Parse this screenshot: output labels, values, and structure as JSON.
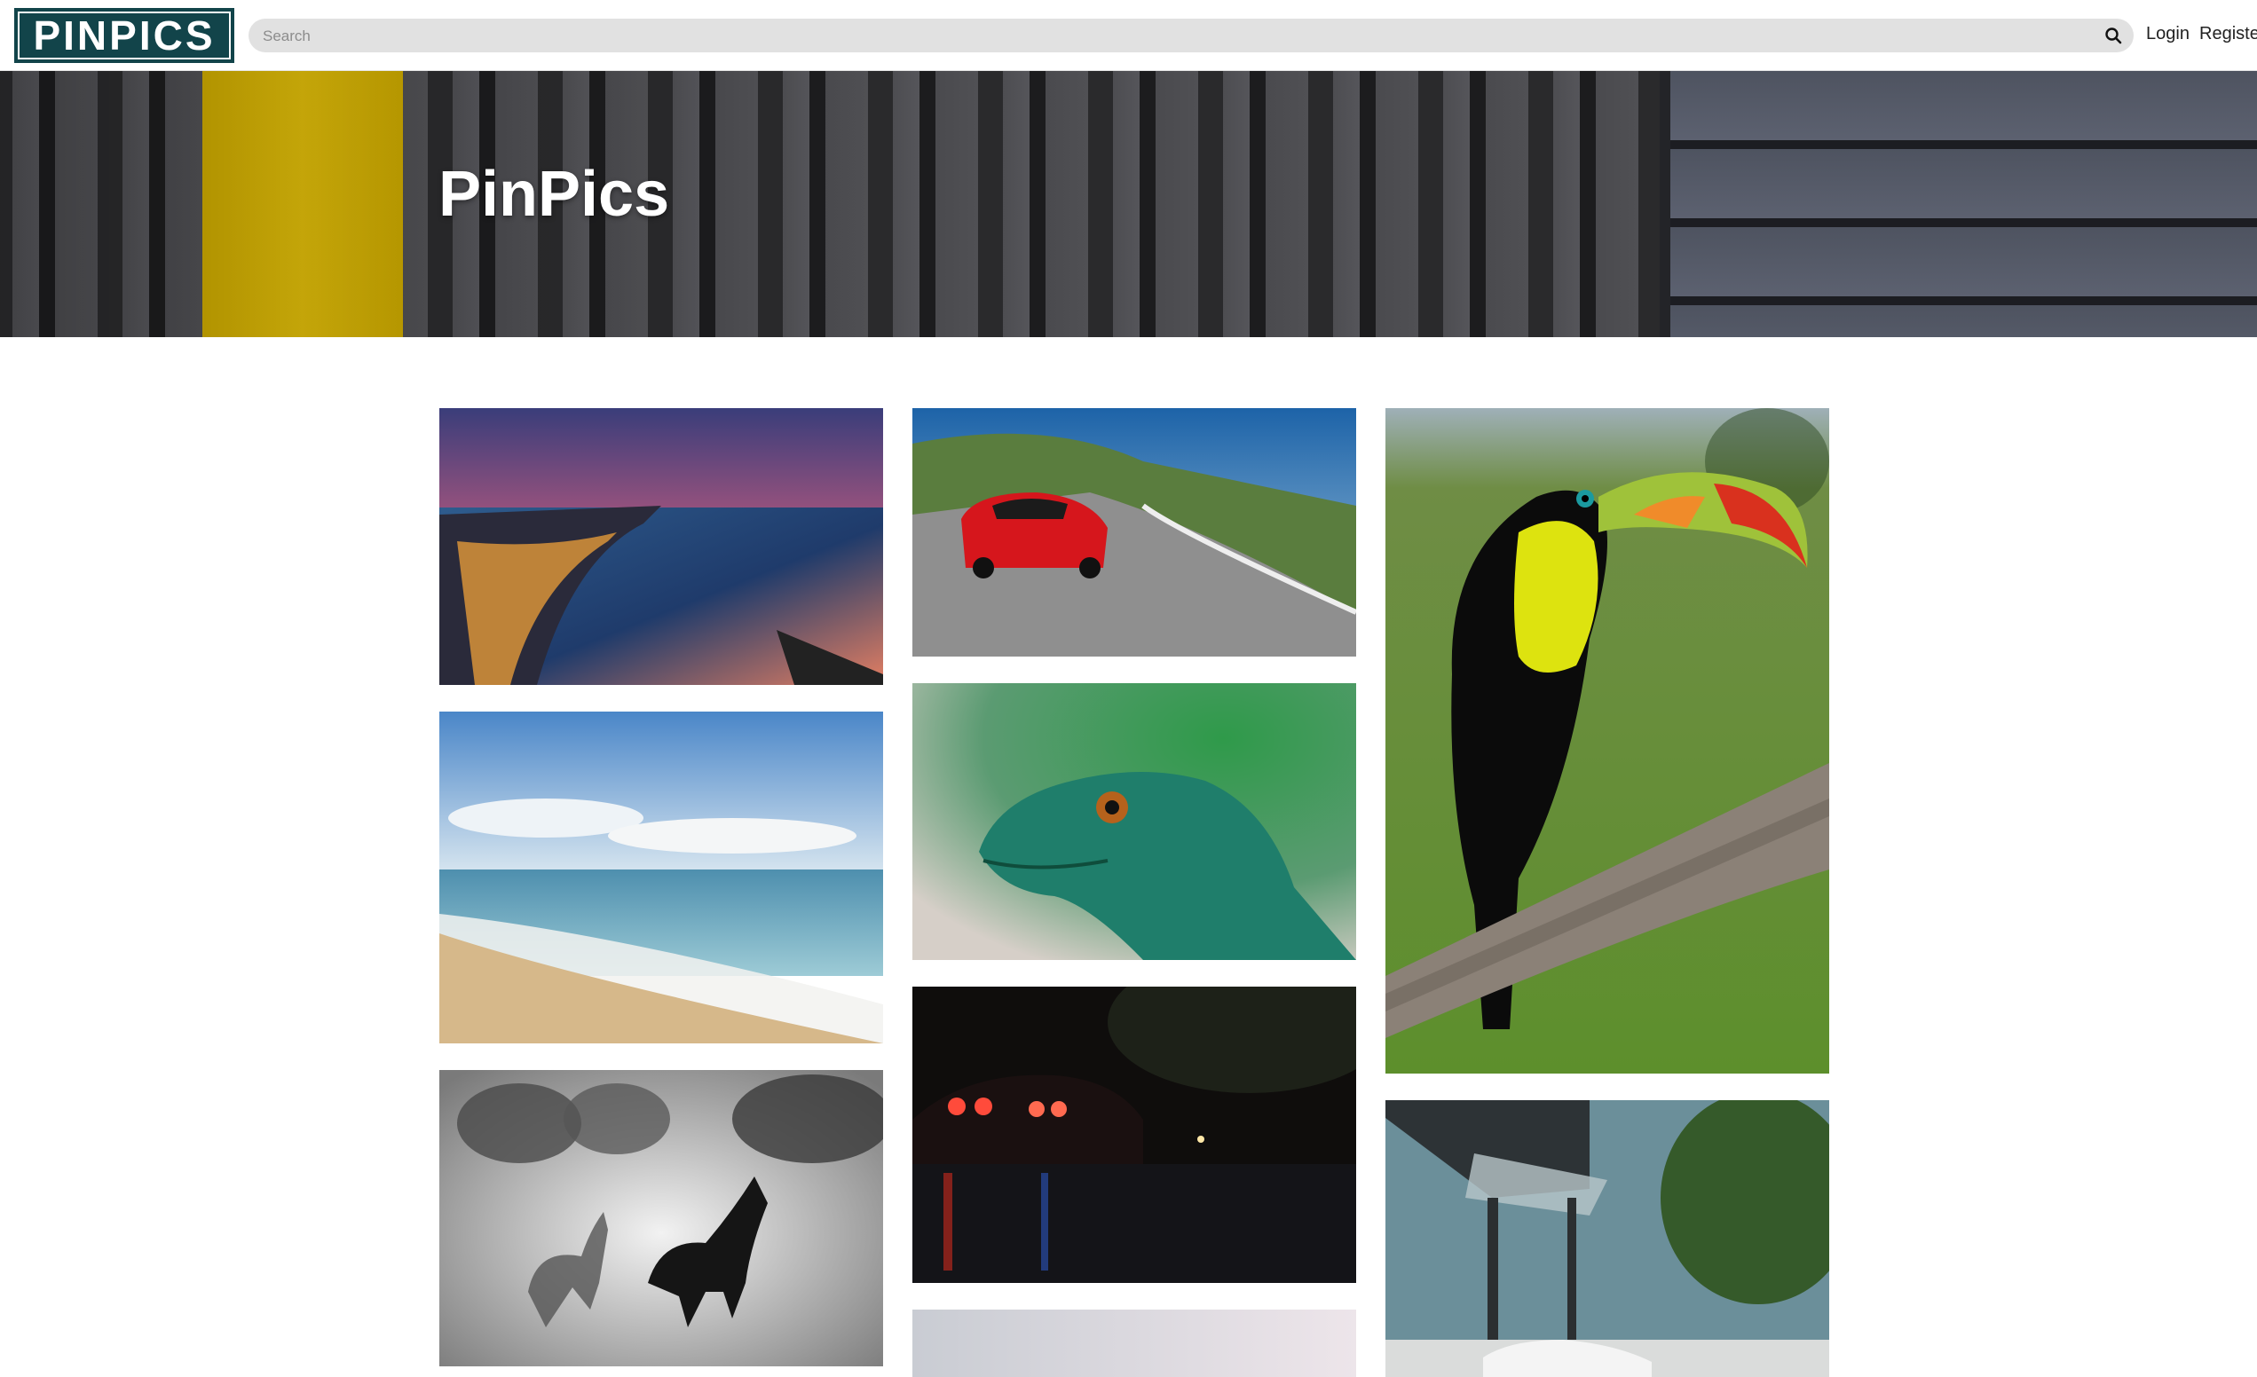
{
  "header": {
    "logo_text": "PINPICS",
    "search": {
      "placeholder": "Search",
      "value": ""
    },
    "search_icon": "search-icon",
    "nav": {
      "login": "Login",
      "register": "Register"
    }
  },
  "hero": {
    "title": "PinPics"
  },
  "gallery": {
    "images": [
      {
        "subject": "city-bay-sunset"
      },
      {
        "subject": "red-sports-car-road"
      },
      {
        "subject": "toucan-on-branch"
      },
      {
        "subject": "beach-waves"
      },
      {
        "subject": "green-lizard"
      },
      {
        "subject": "horses-in-dust"
      },
      {
        "subject": "car-at-night"
      },
      {
        "subject": "sky-image"
      },
      {
        "subject": "car-under-canopy"
      }
    ]
  },
  "colors": {
    "brand": "#12444a",
    "search_bg": "#e1e1e1",
    "hero_yellow": "#d9b70a"
  }
}
